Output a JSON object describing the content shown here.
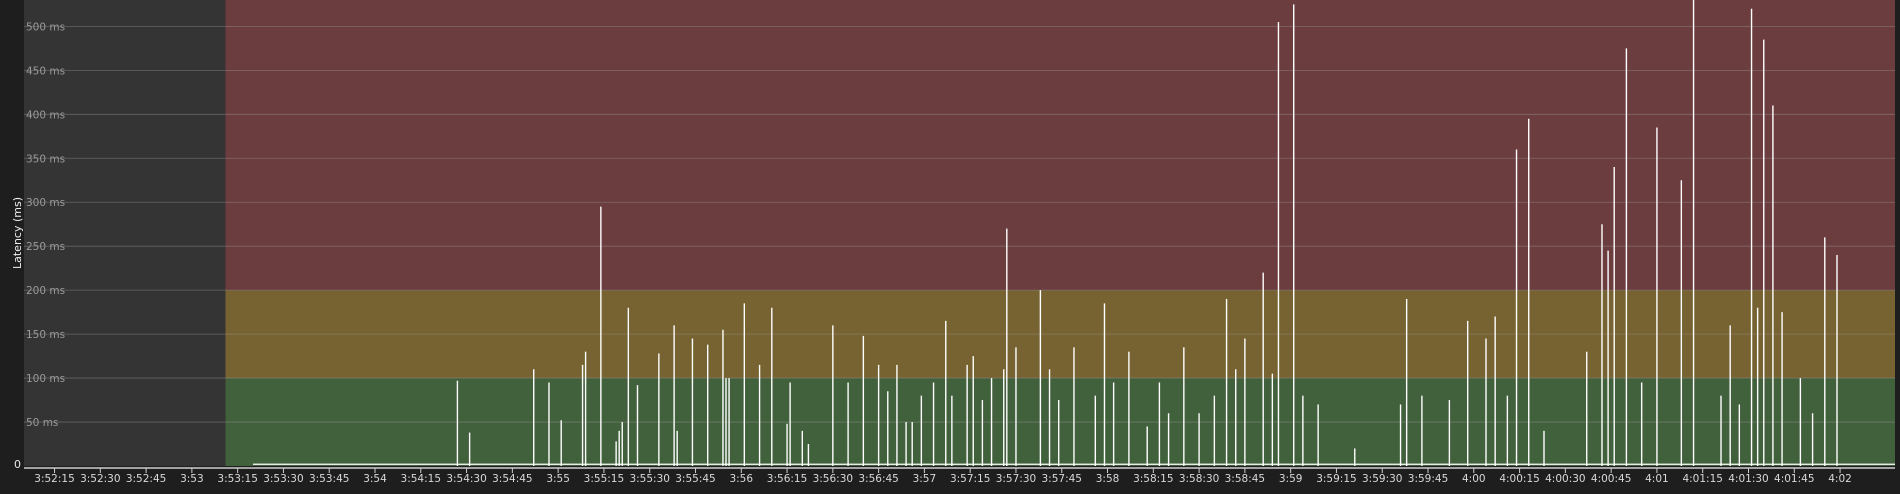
{
  "chart_data": {
    "type": "bar",
    "ylabel": "Latency (ms)",
    "ylim": [
      0,
      530
    ],
    "y_ticks": [
      {
        "value": 50,
        "label": "50 ms"
      },
      {
        "value": 100,
        "label": "100 ms"
      },
      {
        "value": 150,
        "label": "150 ms"
      },
      {
        "value": 200,
        "label": "200 ms"
      },
      {
        "value": 250,
        "label": "250 ms"
      },
      {
        "value": 300,
        "label": "300 ms"
      },
      {
        "value": 350,
        "label": "350 ms"
      },
      {
        "value": 400,
        "label": "400 ms"
      },
      {
        "value": 450,
        "label": "450 ms"
      },
      {
        "value": 500,
        "label": "500 ms"
      }
    ],
    "y_zero_label": "0",
    "x_range": [
      "3:52:05",
      "4:02:18"
    ],
    "x_ticks": [
      "3:52:15",
      "3:52:30",
      "3:52:45",
      "3:53",
      "3:53:15",
      "3:53:30",
      "3:53:45",
      "3:54",
      "3:54:15",
      "3:54:30",
      "3:54:45",
      "3:55",
      "3:55:15",
      "3:55:30",
      "3:55:45",
      "3:56",
      "3:56:15",
      "3:56:30",
      "3:56:45",
      "3:57",
      "3:57:15",
      "3:57:30",
      "3:57:45",
      "3:58",
      "3:58:15",
      "3:58:30",
      "3:58:45",
      "3:59",
      "3:59:15",
      "3:59:30",
      "3:59:45",
      "4:00",
      "4:00:15",
      "4:00:30",
      "4:00:45",
      "4:01",
      "4:01:15",
      "4:01:30",
      "4:01:45",
      "4:02"
    ],
    "no_data_until": "3:53:11",
    "bands": [
      {
        "name": "good",
        "from": 0,
        "to": 100,
        "color": "#41603c"
      },
      {
        "name": "warning",
        "from": 100,
        "to": 200,
        "color": "#776331"
      },
      {
        "name": "bad",
        "from": 200,
        "to": 530,
        "color": "#6b3d3f"
      }
    ],
    "colors": {
      "background": "#1e1e1e",
      "no_data": "#343434",
      "spike": "#ffffff",
      "grid": "#a0a0a0"
    },
    "baseline_ms": 2,
    "spikes": [
      {
        "t": "3:54:27",
        "ms": 97
      },
      {
        "t": "3:54:31",
        "ms": 38
      },
      {
        "t": "3:54:52",
        "ms": 110
      },
      {
        "t": "3:54:57",
        "ms": 95
      },
      {
        "t": "3:55:01",
        "ms": 52
      },
      {
        "t": "3:55:08",
        "ms": 115
      },
      {
        "t": "3:55:09",
        "ms": 130
      },
      {
        "t": "3:55:14",
        "ms": 295
      },
      {
        "t": "3:55:19",
        "ms": 28
      },
      {
        "t": "3:55:20",
        "ms": 40
      },
      {
        "t": "3:55:21",
        "ms": 50
      },
      {
        "t": "3:55:23",
        "ms": 180
      },
      {
        "t": "3:55:26",
        "ms": 92
      },
      {
        "t": "3:55:33",
        "ms": 128
      },
      {
        "t": "3:55:38",
        "ms": 160
      },
      {
        "t": "3:55:39",
        "ms": 40
      },
      {
        "t": "3:55:44",
        "ms": 145
      },
      {
        "t": "3:55:49",
        "ms": 138
      },
      {
        "t": "3:55:54",
        "ms": 155
      },
      {
        "t": "3:55:55",
        "ms": 100
      },
      {
        "t": "3:55:56",
        "ms": 100
      },
      {
        "t": "3:56:01",
        "ms": 185
      },
      {
        "t": "3:56:06",
        "ms": 115
      },
      {
        "t": "3:56:10",
        "ms": 180
      },
      {
        "t": "3:56:15",
        "ms": 48
      },
      {
        "t": "3:56:16",
        "ms": 95
      },
      {
        "t": "3:56:20",
        "ms": 40
      },
      {
        "t": "3:56:22",
        "ms": 25
      },
      {
        "t": "3:56:30",
        "ms": 160
      },
      {
        "t": "3:56:35",
        "ms": 95
      },
      {
        "t": "3:56:40",
        "ms": 148
      },
      {
        "t": "3:56:45",
        "ms": 115
      },
      {
        "t": "3:56:48",
        "ms": 85
      },
      {
        "t": "3:56:51",
        "ms": 115
      },
      {
        "t": "3:56:54",
        "ms": 50
      },
      {
        "t": "3:56:56",
        "ms": 50
      },
      {
        "t": "3:56:59",
        "ms": 80
      },
      {
        "t": "3:57:03",
        "ms": 95
      },
      {
        "t": "3:57:07",
        "ms": 165
      },
      {
        "t": "3:57:09",
        "ms": 80
      },
      {
        "t": "3:57:14",
        "ms": 115
      },
      {
        "t": "3:57:16",
        "ms": 125
      },
      {
        "t": "3:57:19",
        "ms": 75
      },
      {
        "t": "3:57:22",
        "ms": 100
      },
      {
        "t": "3:57:26",
        "ms": 110
      },
      {
        "t": "3:57:27",
        "ms": 270
      },
      {
        "t": "3:57:30",
        "ms": 135
      },
      {
        "t": "3:57:38",
        "ms": 200
      },
      {
        "t": "3:57:41",
        "ms": 110
      },
      {
        "t": "3:57:44",
        "ms": 75
      },
      {
        "t": "3:57:49",
        "ms": 135
      },
      {
        "t": "3:57:56",
        "ms": 80
      },
      {
        "t": "3:57:59",
        "ms": 185
      },
      {
        "t": "3:58:02",
        "ms": 95
      },
      {
        "t": "3:58:07",
        "ms": 130
      },
      {
        "t": "3:58:13",
        "ms": 45
      },
      {
        "t": "3:58:17",
        "ms": 95
      },
      {
        "t": "3:58:20",
        "ms": 60
      },
      {
        "t": "3:58:25",
        "ms": 135
      },
      {
        "t": "3:58:30",
        "ms": 60
      },
      {
        "t": "3:58:35",
        "ms": 80
      },
      {
        "t": "3:58:39",
        "ms": 190
      },
      {
        "t": "3:58:42",
        "ms": 110
      },
      {
        "t": "3:58:45",
        "ms": 145
      },
      {
        "t": "3:58:51",
        "ms": 220
      },
      {
        "t": "3:58:54",
        "ms": 105
      },
      {
        "t": "3:58:56",
        "ms": 505
      },
      {
        "t": "3:59:01",
        "ms": 525
      },
      {
        "t": "3:59:04",
        "ms": 80
      },
      {
        "t": "3:59:09",
        "ms": 70
      },
      {
        "t": "3:59:21",
        "ms": 20
      },
      {
        "t": "3:59:36",
        "ms": 70
      },
      {
        "t": "3:59:38",
        "ms": 190
      },
      {
        "t": "3:59:43",
        "ms": 80
      },
      {
        "t": "3:59:52",
        "ms": 75
      },
      {
        "t": "3:59:58",
        "ms": 165
      },
      {
        "t": "4:00:04",
        "ms": 145
      },
      {
        "t": "4:00:07",
        "ms": 170
      },
      {
        "t": "4:00:11",
        "ms": 80
      },
      {
        "t": "4:00:14",
        "ms": 360
      },
      {
        "t": "4:00:18",
        "ms": 395
      },
      {
        "t": "4:00:23",
        "ms": 40
      },
      {
        "t": "4:00:37",
        "ms": 130
      },
      {
        "t": "4:00:42",
        "ms": 275
      },
      {
        "t": "4:00:44",
        "ms": 245
      },
      {
        "t": "4:00:46",
        "ms": 340
      },
      {
        "t": "4:00:50",
        "ms": 475
      },
      {
        "t": "4:00:55",
        "ms": 95
      },
      {
        "t": "4:01:00",
        "ms": 385
      },
      {
        "t": "4:01:08",
        "ms": 325
      },
      {
        "t": "4:01:12",
        "ms": 530
      },
      {
        "t": "4:01:21",
        "ms": 80
      },
      {
        "t": "4:01:24",
        "ms": 160
      },
      {
        "t": "4:01:27",
        "ms": 70
      },
      {
        "t": "4:01:31",
        "ms": 520
      },
      {
        "t": "4:01:33",
        "ms": 180
      },
      {
        "t": "4:01:35",
        "ms": 485
      },
      {
        "t": "4:01:38",
        "ms": 410
      },
      {
        "t": "4:01:41",
        "ms": 175
      },
      {
        "t": "4:01:47",
        "ms": 100
      },
      {
        "t": "4:01:51",
        "ms": 60
      },
      {
        "t": "4:01:55",
        "ms": 260
      },
      {
        "t": "4:01:59",
        "ms": 240
      }
    ]
  }
}
